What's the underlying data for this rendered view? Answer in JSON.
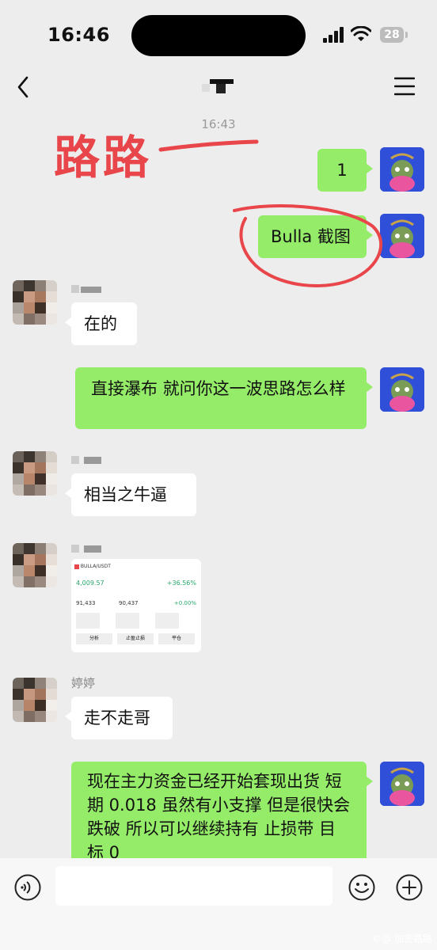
{
  "status_bar": {
    "time": "16:46",
    "battery": "28"
  },
  "nav": {
    "title": "",
    "back_icon": "chevron-left-icon",
    "menu_icon": "menu-icon"
  },
  "chat": {
    "timestamp": "16:43",
    "annotation": "路路",
    "messages": [
      {
        "side": "me",
        "text": "1"
      },
      {
        "side": "me",
        "text": "Bulla 截图"
      },
      {
        "side": "other",
        "text": "在的"
      },
      {
        "side": "me",
        "text": "直接瀑布 就问你这一波思路怎么样"
      },
      {
        "side": "other",
        "text": "相当之牛逼"
      },
      {
        "side": "other",
        "type": "image",
        "text": ""
      },
      {
        "side": "other",
        "sender": "婷婷",
        "text": "走不走哥"
      },
      {
        "side": "me",
        "text": "现在主力资金已经开始套现出货 短期 0.018 虽然有小支撑 但是很快会跌破 所以可以继续持有 止损带 目标 0"
      }
    ]
  },
  "screenshot_card": {
    "header": "BULLA/USDT",
    "cells": [
      [
        "4,009.57",
        "+36.56%"
      ],
      [
        "91,433",
        "90,437",
        "+0.00%"
      ]
    ],
    "buttons": [
      "分析",
      "止盈止损",
      "平仓"
    ]
  },
  "input_bar": {
    "voice_icon": "voice-icon",
    "emoji_icon": "emoji-icon",
    "add_icon": "plus-icon"
  },
  "watermark": "©@ 加密路路",
  "colors": {
    "my_bubble": "#95ec69",
    "other_bubble": "#ffffff",
    "annotation": "#e8464b",
    "background": "#ededed"
  }
}
